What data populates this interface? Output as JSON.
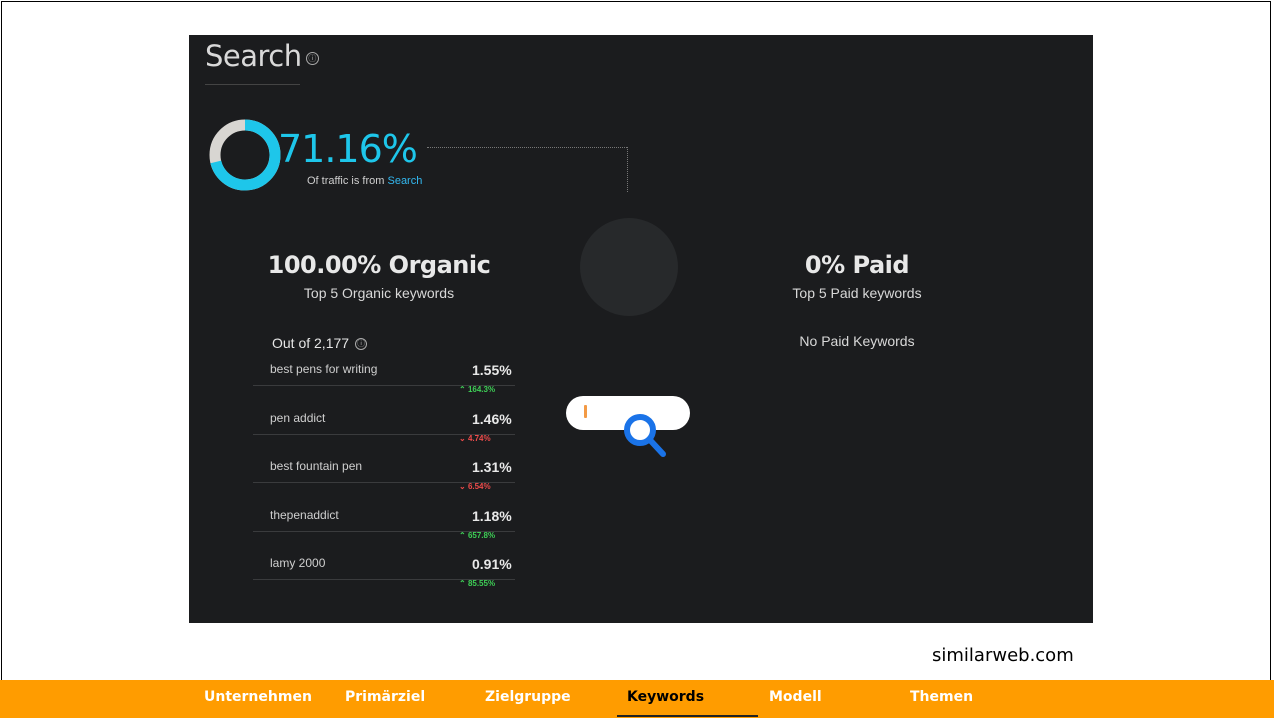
{
  "panel": {
    "title": "Search",
    "info_glyph": "ⓘ",
    "traffic_pct": "71.16%",
    "traffic_pct_value": 71.16,
    "traffic_sub_prefix": "Of traffic is from",
    "traffic_sub_source": "Search",
    "organic": {
      "heading": "100.00% Organic",
      "subheading": "Top 5 Organic keywords"
    },
    "paid": {
      "heading": "0% Paid",
      "subheading": "Top 5 Paid keywords",
      "empty_text": "No Paid Keywords"
    },
    "out_of": "Out of 2,177",
    "keywords": [
      {
        "name": "best pens for writing",
        "share": "1.55%",
        "change": "164.3%",
        "direction": "up"
      },
      {
        "name": "pen addict",
        "share": "1.46%",
        "change": "4.74%",
        "direction": "down"
      },
      {
        "name": "best fountain pen",
        "share": "1.31%",
        "change": "6.54%",
        "direction": "down"
      },
      {
        "name": "thepenaddict",
        "share": "1.18%",
        "change": "657.8%",
        "direction": "up"
      },
      {
        "name": "lamy 2000",
        "share": "0.91%",
        "change": "85.55%",
        "direction": "up"
      }
    ]
  },
  "source": "similarweb.com",
  "nav": {
    "items": [
      "Unternehmen",
      "Primärziel",
      "Zielgruppe",
      "Keywords",
      "Modell",
      "Themen"
    ],
    "active": "Keywords"
  },
  "colors": {
    "accent": "#1ec6ea",
    "panel_bg": "#1b1c1e",
    "nav_bg": "#ff9c00",
    "up": "#3ecf56",
    "down": "#ef4b4b"
  },
  "icons": {
    "title_info": "info-icon",
    "donut": "donut-chart",
    "search": "magnifier-icon",
    "change_up": "chevron-up-icon",
    "change_down": "chevron-down-icon"
  }
}
